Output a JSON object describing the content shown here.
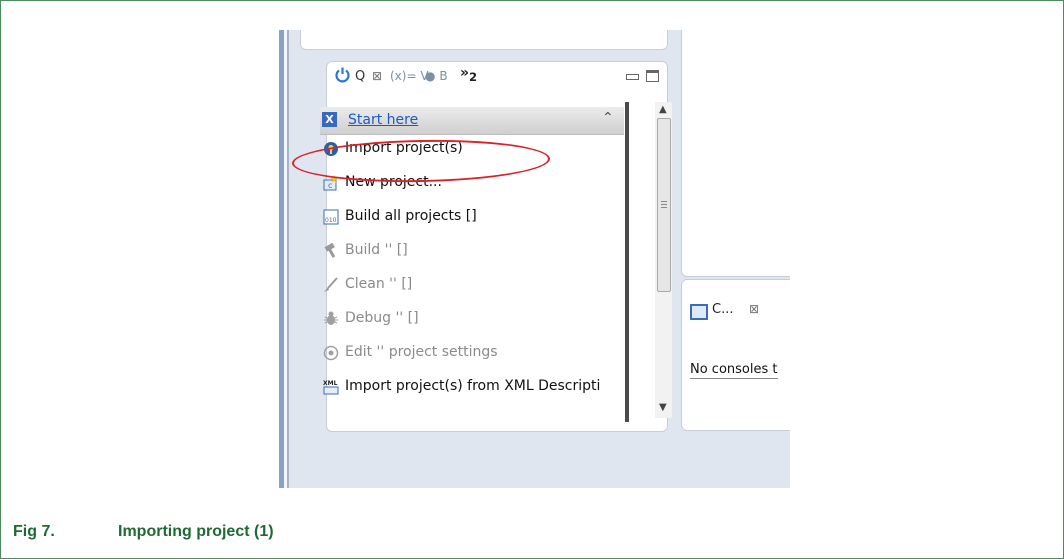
{
  "tabs": {
    "quickstart": "Q",
    "variables": "V",
    "breakpoints": "B",
    "overflow": "»",
    "overflow_count": "2",
    "close_glyph": "⊠",
    "variables_prefix": "(x)="
  },
  "start_section": {
    "label": "Start here"
  },
  "menu_items": [
    {
      "label": "Import project(s)",
      "icon": "import-bulb-icon",
      "enabled": true
    },
    {
      "label": "New project...",
      "icon": "new-project-icon",
      "enabled": true
    },
    {
      "label": "Build all projects []",
      "icon": "build-all-icon",
      "enabled": true
    },
    {
      "label": "Build '' []",
      "icon": "hammer-icon",
      "enabled": false
    },
    {
      "label": "Clean '' []",
      "icon": "brush-icon",
      "enabled": false
    },
    {
      "label": "Debug '' []",
      "icon": "bug-icon",
      "enabled": false
    },
    {
      "label": "Edit '' project settings",
      "icon": "settings-icon",
      "enabled": false
    },
    {
      "label": "Import project(s) from XML Descripti",
      "icon": "xml-icon",
      "enabled": true
    }
  ],
  "console": {
    "tab_label": "C...",
    "message": "No consoles t"
  },
  "caption": {
    "figure": "Fig 7.",
    "title": "Importing project (1)"
  },
  "colors": {
    "caption": "#1f6a33",
    "highlight_ring": "#d9232a",
    "link": "#1a5bc4"
  }
}
